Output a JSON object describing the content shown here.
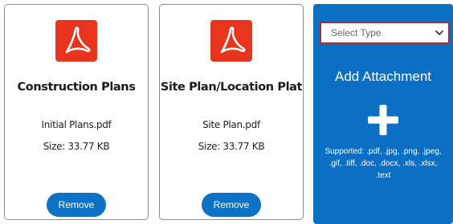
{
  "attachments": [
    {
      "icon": "pdf-file-icon",
      "title": "Construction Plans",
      "file_name": "Initial Plans.pdf",
      "file_size": "Size: 33.77 KB",
      "remove_label": "Remove"
    },
    {
      "icon": "pdf-file-icon",
      "title": "Site Plan/Location Plat",
      "file_name": "Site Plan.pdf",
      "file_size": "Size: 33.77 KB",
      "remove_label": "Remove"
    }
  ],
  "upload": {
    "select_value": "Select Type",
    "title": "Add Attachment",
    "icon": "plus-icon",
    "supported": "Supported: .pdf, .jpg, .png, .jpeg, .gif, .tiff, .doc, .docx, .xls, .xlsx, .text"
  },
  "colors": {
    "pdf_red": "#e8341c",
    "button_blue": "#0b72c5",
    "upload_blue": "#0b6fc4",
    "select_border": "#b42a2a"
  }
}
